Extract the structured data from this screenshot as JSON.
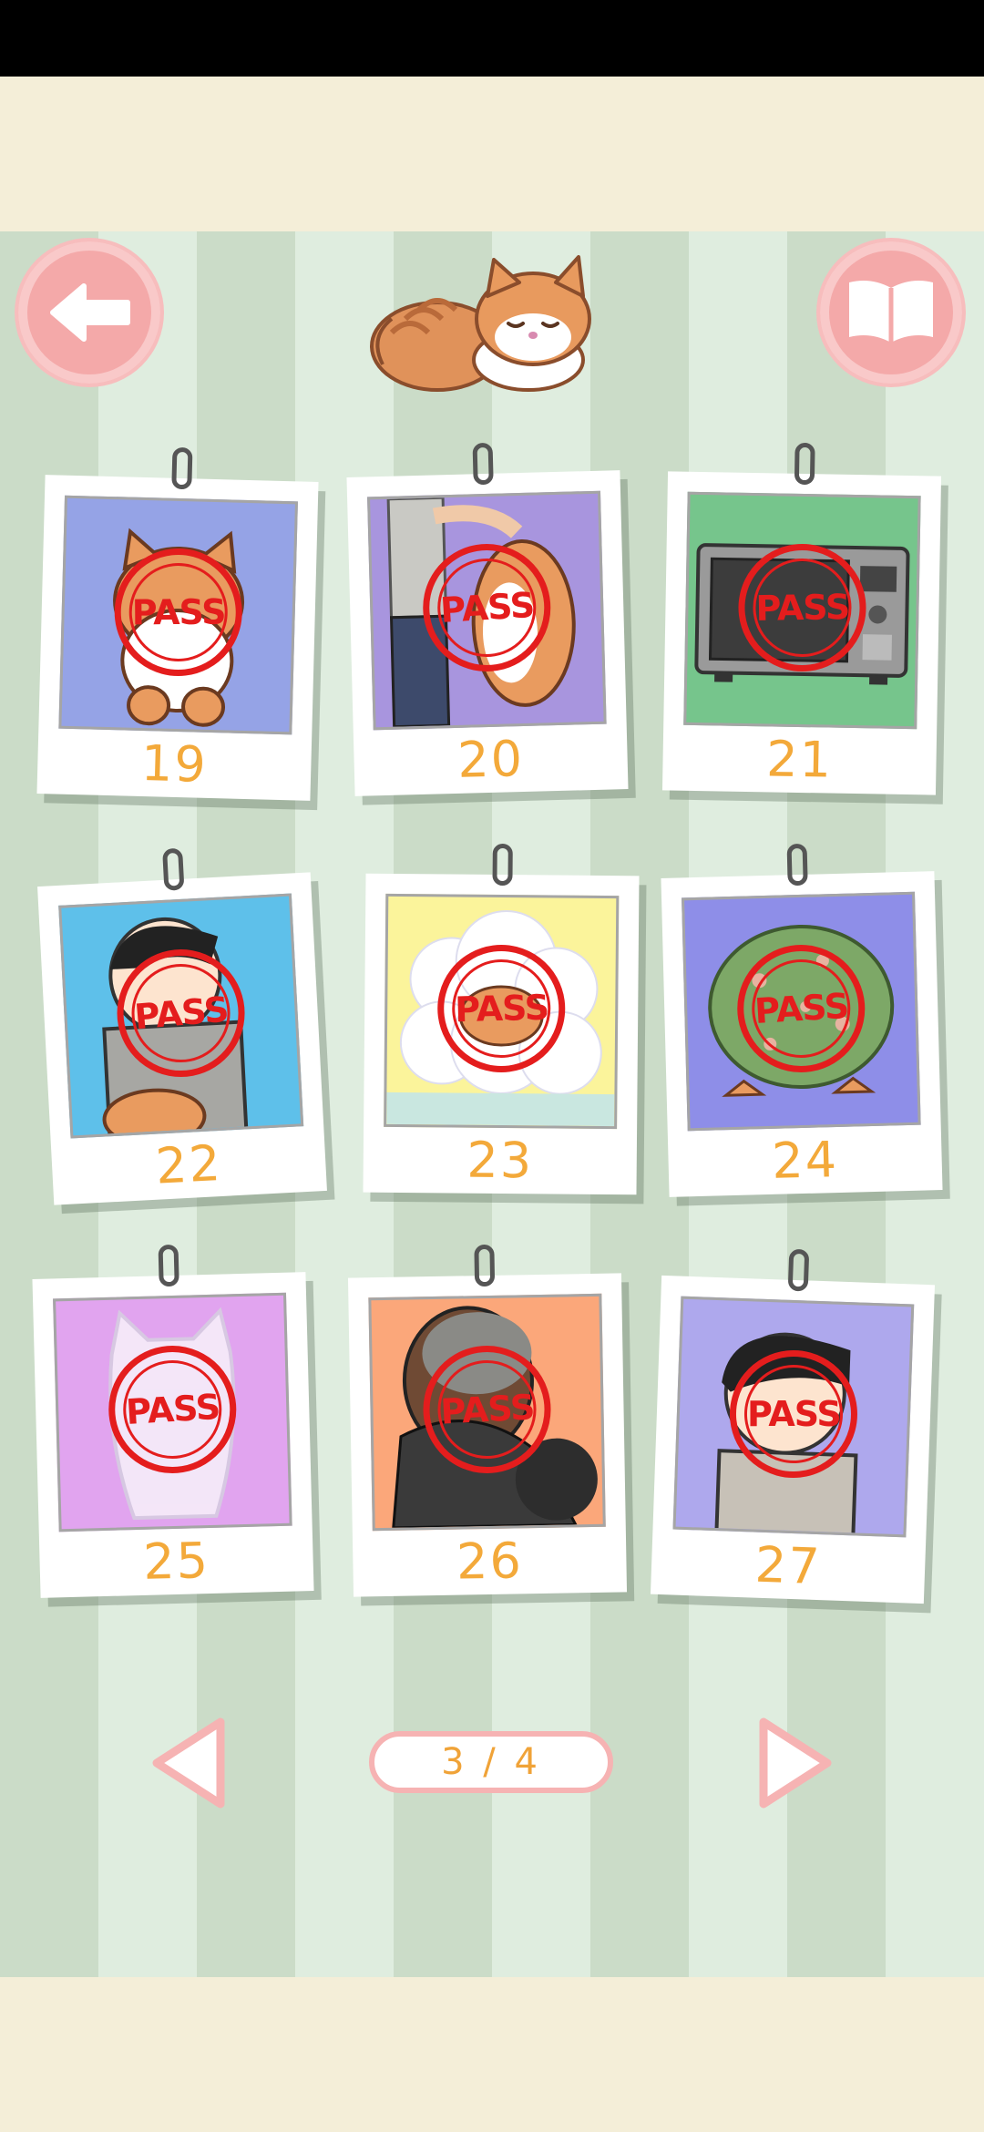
{
  "header": {
    "back_icon": "arrow-left-icon",
    "book_icon": "open-book-icon",
    "mascot": "sleeping-cat-icon"
  },
  "levels": [
    {
      "number": "19",
      "status": "PASS",
      "scene": "cat-curled"
    },
    {
      "number": "20",
      "status": "PASS",
      "scene": "person-holding-cat"
    },
    {
      "number": "21",
      "status": "PASS",
      "scene": "microwave"
    },
    {
      "number": "22",
      "status": "PASS",
      "scene": "boy-with-cat"
    },
    {
      "number": "23",
      "status": "PASS",
      "scene": "cat-in-clouds"
    },
    {
      "number": "24",
      "status": "PASS",
      "scene": "cat-in-bush"
    },
    {
      "number": "25",
      "status": "PASS",
      "scene": "ghost-cat"
    },
    {
      "number": "26",
      "status": "PASS",
      "scene": "man-with-beard"
    },
    {
      "number": "27",
      "status": "PASS",
      "scene": "boy-smiling"
    }
  ],
  "pagination": {
    "label": "3 / 4",
    "prev_icon": "triangle-left-icon",
    "next_icon": "triangle-right-icon"
  },
  "colors": {
    "stamp_red": "#e41d1d",
    "number_orange": "#f3a93a",
    "button_pink": "#f4a9a9",
    "stripe_dark": "#cbdcc8",
    "stripe_light": "#dfeddf",
    "cream": "#f4eed8"
  }
}
